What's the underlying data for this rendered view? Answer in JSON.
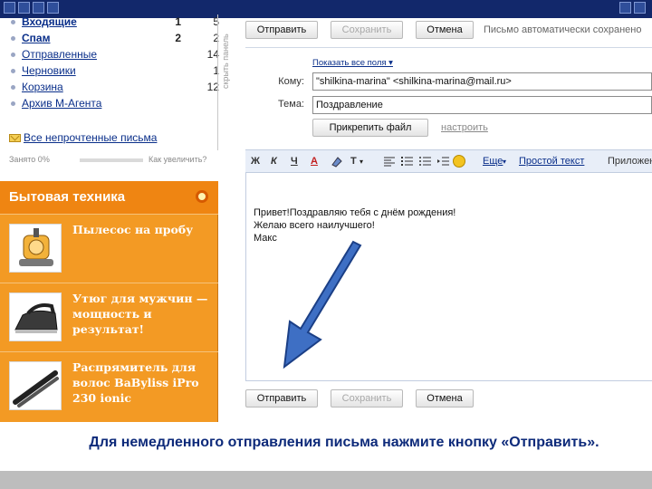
{
  "folders": [
    {
      "name": "Входящие",
      "new": "1",
      "total": "5"
    },
    {
      "name": "Спам",
      "new": "2",
      "total": "2"
    },
    {
      "name": "Отправленные",
      "new": "",
      "total": "14"
    },
    {
      "name": "Черновики",
      "new": "",
      "total": "1"
    },
    {
      "name": "Корзина",
      "new": "",
      "total": "12"
    },
    {
      "name": "Архив М-Агента",
      "new": "",
      "total": ""
    }
  ],
  "hide_panel": "скрыть панель",
  "unread_link": "Все непрочтенные письма",
  "usage": {
    "label": "Занято 0%",
    "fraction": 0.0,
    "help": "Как увеличить?"
  },
  "ad": {
    "title": "Бытовая техника",
    "items": [
      {
        "text": "Пылесос на пробу",
        "icon": "vacuum-cleaner-icon"
      },
      {
        "text": "Утюг для мужчин — мощность и результат!",
        "icon": "iron-icon"
      },
      {
        "text": "Распрямитель для волос BaByliss iPro 230 ionic",
        "icon": "hair-straightener-icon"
      }
    ]
  },
  "compose": {
    "send": "Отправить",
    "save": "Сохранить",
    "cancel": "Отмена",
    "autosave": "Письмо автоматически сохранено",
    "show_fields": "Показать все поля ▾",
    "to_label": "Кому:",
    "to_value": "\"shilkina-marina\" <shilkina-marina@mail.ru>",
    "subject_label": "Тема:",
    "subject_value": "Поздравление",
    "attach": "Прикрепить файл",
    "attach_hint": "настроить"
  },
  "toolbar": {
    "bold": "Ж",
    "italic": "К",
    "underline": "Ч",
    "text_color": "A",
    "font_size": "T",
    "more": "Еще",
    "plain_text": "Простой текст",
    "apps": "Приложения"
  },
  "body_lines": [
    "Привет!Поздравляю тебя с днём рождения!",
    "Желаю всего наилучшего!",
    "Макс"
  ],
  "caption": "Для немедленного отправления письма нажмите кнопку «Отправить».",
  "colors": {
    "nav": "#12286b",
    "ad": "#f39a24",
    "arrow": "#2f5fb3",
    "caption": "#0d2a7a"
  }
}
